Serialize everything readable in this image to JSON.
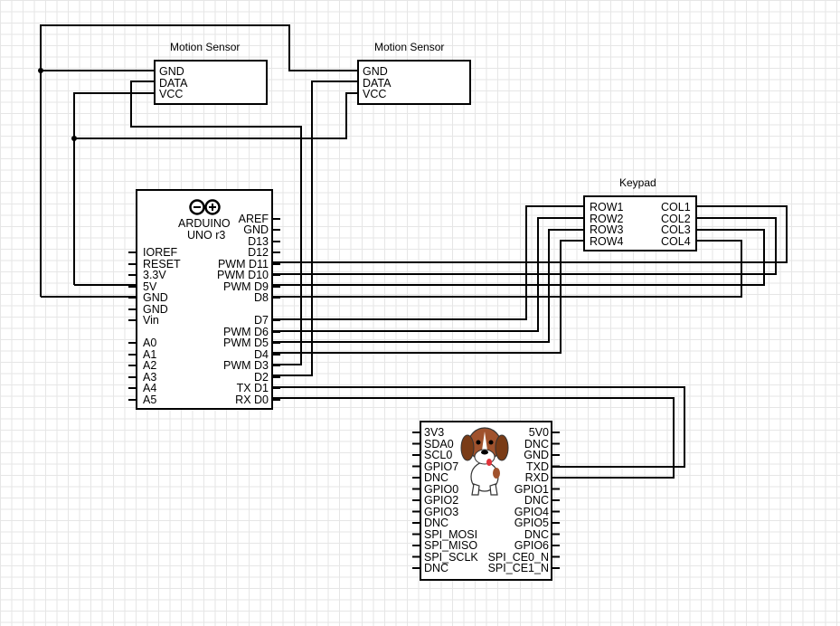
{
  "motion_sensor_1": {
    "title": "Motion Sensor",
    "pins": [
      "GND",
      "DATA",
      "VCC"
    ]
  },
  "motion_sensor_2": {
    "title": "Motion Sensor",
    "pins": [
      "GND",
      "DATA",
      "VCC"
    ]
  },
  "keypad": {
    "title": "Keypad",
    "rows": [
      "ROW1",
      "ROW2",
      "ROW3",
      "ROW4"
    ],
    "cols": [
      "COL1",
      "COL2",
      "COL3",
      "COL4"
    ]
  },
  "arduino": {
    "logo_text": "ARDUINO",
    "model": "UNO r3",
    "left_pins": [
      "IOREF",
      "RESET",
      "3.3V",
      "5V",
      "GND",
      "GND",
      "Vin",
      "A0",
      "A1",
      "A2",
      "A3",
      "A4",
      "A5"
    ],
    "right_pins": [
      "AREF",
      "GND",
      "D13",
      "D12",
      "PWM D11",
      "PWM D10",
      "PWM D9",
      "D8",
      "D7",
      "PWM D6",
      "PWM D5",
      "D4",
      "PWM D3",
      "D2",
      "TX D1",
      "RX D0"
    ]
  },
  "beaglebone": {
    "left_pins": [
      "3V3",
      "SDA0",
      "SCL0",
      "GPIO7",
      "DNC",
      "GPIO0",
      "GPIO2",
      "GPIO3",
      "DNC",
      "SPI_MOSI",
      "SPI_MISO",
      "SPI_SCLK",
      "DNC"
    ],
    "right_pins": [
      "5V0",
      "DNC",
      "GND",
      "TXD",
      "RXD",
      "GPIO1",
      "DNC",
      "GPIO4",
      "GPIO5",
      "DNC",
      "GPIO6",
      "SPI_CE0_N",
      "SPI_CE1_N"
    ]
  }
}
